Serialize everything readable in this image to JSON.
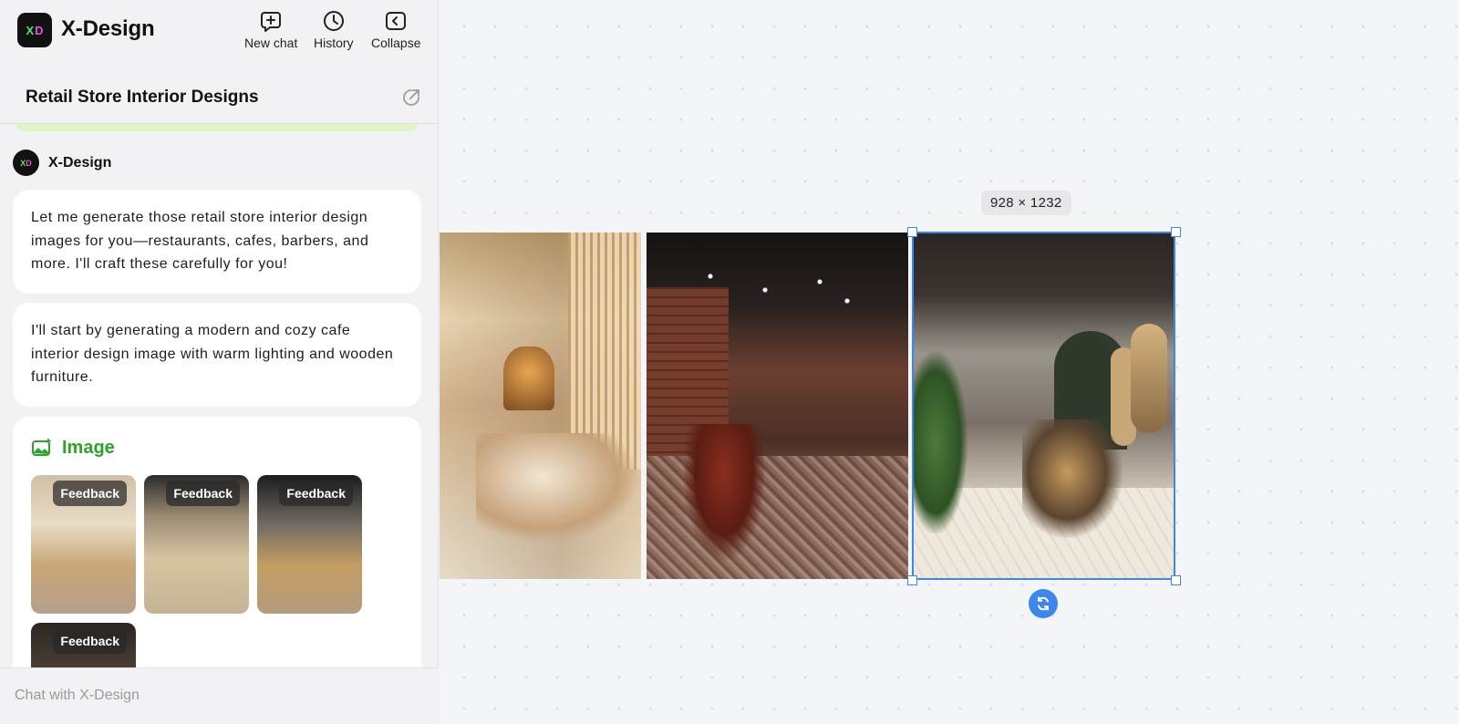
{
  "app": {
    "brand": "X-Design",
    "logo_x": "X",
    "logo_d": "D"
  },
  "topbar": {
    "new_chat_label": "New chat",
    "history_label": "History",
    "collapse_label": "Collapse"
  },
  "session": {
    "title": "Retail Store Interior Designs"
  },
  "chat": {
    "assistant_name": "X-Design",
    "messages": [
      {
        "text": "Let me generate those retail store interior design images for you—restaurants, cafes, barbers, and more. I'll craft these carefully for you!"
      },
      {
        "text": "I'll start by generating a modern and cozy cafe interior design image with warm lighting and wooden furniture."
      }
    ],
    "image_card": {
      "title": "Image",
      "thumbnails": [
        {
          "feedback_label": "Feedback"
        },
        {
          "feedback_label": "Feedback"
        },
        {
          "feedback_label": "Feedback"
        },
        {
          "feedback_label": "Feedback"
        }
      ]
    }
  },
  "composer": {
    "placeholder": "Chat with X-Design"
  },
  "canvas": {
    "selected_dimensions": "928 × 1232"
  },
  "colors": {
    "accent": "#3d86f0",
    "image_title": "#2aa52a",
    "logo_green": "#5be36a",
    "logo_pink": "#e84fd8"
  }
}
